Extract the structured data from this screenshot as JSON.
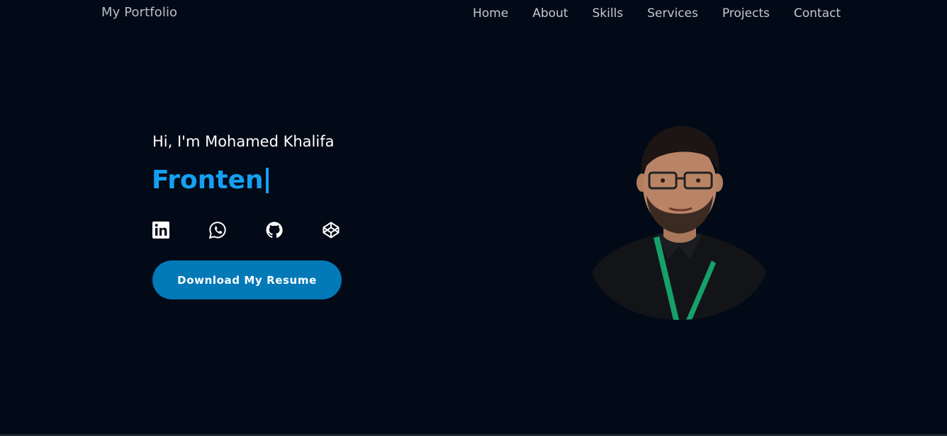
{
  "navbar": {
    "brand": "My Portfolio",
    "links": [
      "Home",
      "About",
      "Skills",
      "Services",
      "Projects",
      "Contact"
    ]
  },
  "hero": {
    "greeting": "Hi, I'm Mohamed Khalifa",
    "typed_role": "Fronten",
    "socials": [
      {
        "icon": "linkedin-icon"
      },
      {
        "icon": "whatsapp-icon"
      },
      {
        "icon": "github-icon"
      },
      {
        "icon": "codepen-icon"
      }
    ],
    "resume_button": "Download My Resume"
  },
  "colors": {
    "background": "#020a17",
    "accent": "#14a0f2",
    "button": "#0379b8",
    "nav_text": "#c4c8cf"
  }
}
